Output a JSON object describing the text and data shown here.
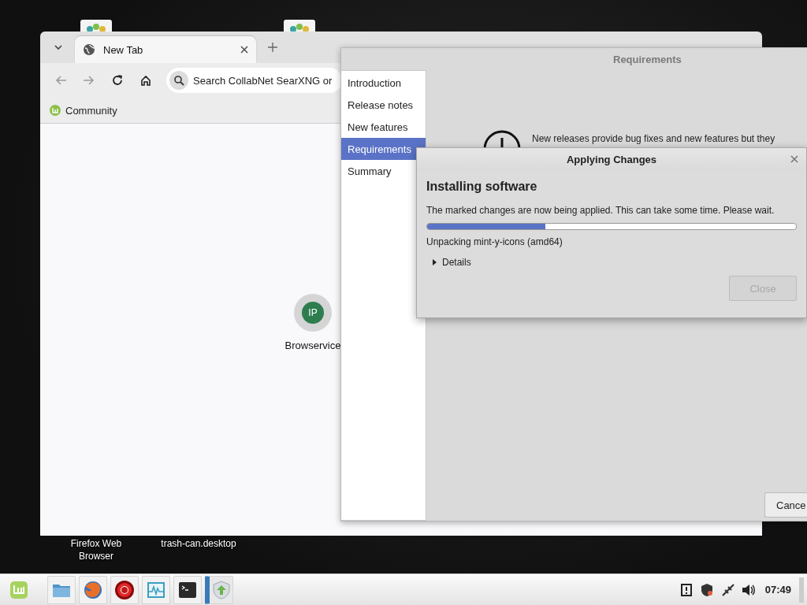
{
  "desktop": {
    "icons": [
      {
        "label": "Firefox Web Browser"
      },
      {
        "label": "trash-can.desktop"
      }
    ]
  },
  "browser": {
    "tabs": [
      {
        "title": "New Tab",
        "selected": true
      }
    ],
    "search": {
      "placeholder": "Search CollabNet SearXNG or"
    },
    "bookmarks": [
      {
        "label": "Community"
      }
    ],
    "shortcuts": [
      {
        "initials": "IP",
        "label": "Browservice"
      }
    ]
  },
  "upgrade_window": {
    "title": "Requirements",
    "steps": [
      {
        "label": "Introduction",
        "selected": false
      },
      {
        "label": "Release notes",
        "selected": false
      },
      {
        "label": "New features",
        "selected": false
      },
      {
        "label": "Requirements",
        "selected": true
      },
      {
        "label": "Summary",
        "selected": false
      }
    ],
    "message": "New releases provide bug fixes and new features but they",
    "buttons": [
      {
        "label": "Cance"
      }
    ]
  },
  "dialog": {
    "title": "Applying Changes",
    "heading": "Installing software",
    "message": "The marked changes are now being applied. This can take some time. Please wait.",
    "progress": {
      "level": 0.32
    },
    "status": "Unpacking mint-y-icons (amd64)",
    "details": {
      "label": "Details",
      "expanded": false
    },
    "buttons": [
      {
        "label": "Close",
        "disabled": true
      }
    ]
  },
  "taskbar": {
    "launchers": [
      {
        "kind": "menu",
        "active": false
      },
      {
        "kind": "files",
        "active": false
      },
      {
        "kind": "firefox",
        "active": false
      },
      {
        "kind": "ring",
        "active": false
      },
      {
        "kind": "monitor",
        "active": false
      },
      {
        "kind": "terminal",
        "active": false
      },
      {
        "kind": "update",
        "active": true
      }
    ],
    "tray": [
      {
        "kind": "clipboard"
      },
      {
        "kind": "shield"
      },
      {
        "kind": "network"
      },
      {
        "kind": "volume"
      }
    ],
    "clock": "07:49"
  }
}
